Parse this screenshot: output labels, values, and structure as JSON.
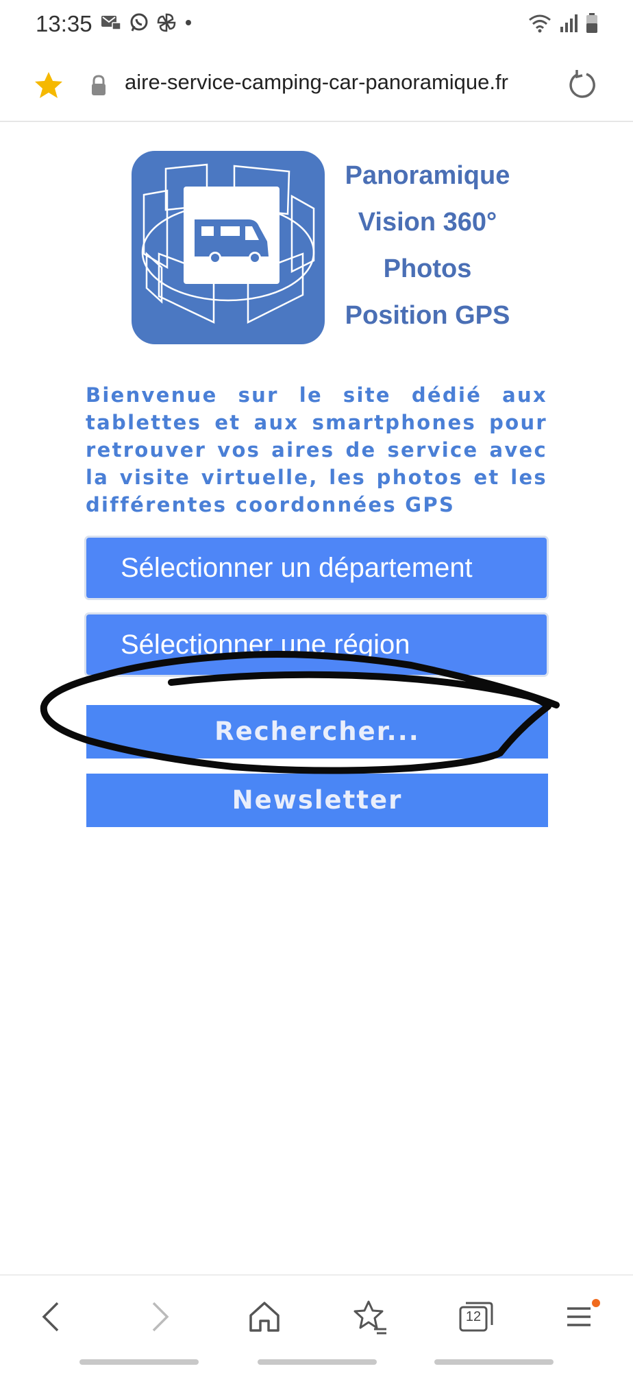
{
  "status_bar": {
    "time": "13:35"
  },
  "browser": {
    "url": "aire-service-camping-car-panoramique.fr",
    "tab_count": "12"
  },
  "logo": {
    "lines": [
      "Panoramique",
      "Vision 360°",
      "Photos",
      "Position GPS"
    ]
  },
  "welcome_text": "Bienvenue sur le site dédié aux tablettes et aux smartphones pour retrouver vos aires de service avec la visite virtuelle, les photos et les différentes coordonnées GPS",
  "selects": {
    "department": "Sélectionner un département",
    "region": "Sélectionner une région"
  },
  "buttons": {
    "search": "Rechercher...",
    "newsletter": "Newsletter"
  },
  "colors": {
    "accent": "#4a86f5",
    "text_blue": "#4a7fd6",
    "logo_blue": "#4b78c2",
    "star": "#f5b800",
    "notification_dot": "#f06a1d"
  },
  "icons": {
    "status_left": [
      "message-icon",
      "whatsapp-icon",
      "pinwheel-icon",
      "dot-icon"
    ],
    "status_right": [
      "wifi-icon",
      "signal-icon",
      "battery-icon"
    ],
    "nav": [
      "back-icon",
      "forward-icon",
      "home-icon",
      "bookmarks-icon",
      "tabs-icon",
      "menu-icon"
    ]
  }
}
